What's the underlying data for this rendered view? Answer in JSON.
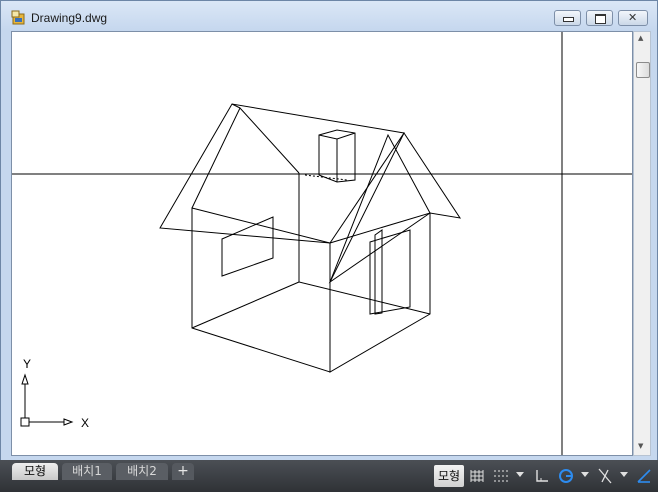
{
  "window": {
    "title": "Drawing9.dwg",
    "min_glyph": "▭",
    "max_glyph": "▢",
    "close_glyph": "✕"
  },
  "ucs": {
    "y_label": "Y",
    "x_label": "X"
  },
  "tabs": [
    {
      "label": "모형",
      "active": true
    },
    {
      "label": "배치1",
      "active": false
    },
    {
      "label": "배치2",
      "active": false
    }
  ],
  "add_tab_label": "+",
  "status": {
    "mode_label": "모형",
    "icons": [
      "grid-icon",
      "snap-icon",
      "ortho-icon",
      "polar-icon",
      "osnap-icon",
      "lineweight-icon"
    ]
  },
  "colors": {
    "canvas_bg": "#ffffff",
    "crosshair": "#000000",
    "statusbar": "#3a3d42",
    "accent": "#1f7ae0"
  }
}
